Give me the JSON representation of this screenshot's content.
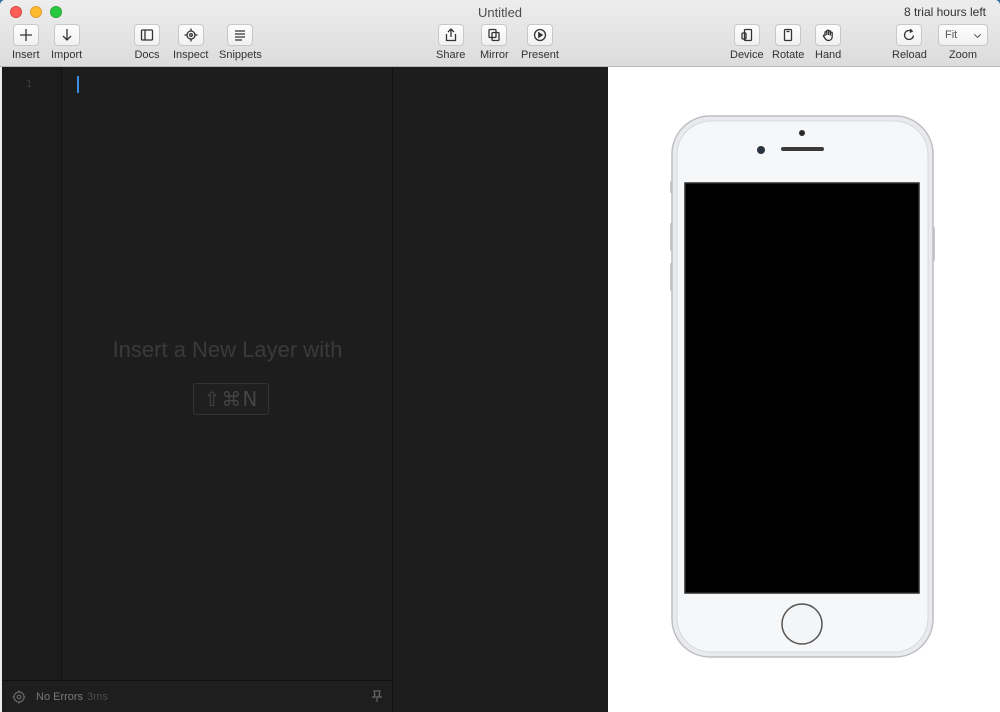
{
  "window": {
    "title": "Untitled",
    "trial_notice": "8 trial hours left"
  },
  "toolbar": {
    "insert": "Insert",
    "import": "Import",
    "docs": "Docs",
    "inspect": "Inspect",
    "snippets": "Snippets",
    "share": "Share",
    "mirror": "Mirror",
    "present": "Present",
    "device": "Device",
    "rotate": "Rotate",
    "hand": "Hand",
    "reload": "Reload",
    "zoom": "Zoom",
    "zoom_value": "Fit"
  },
  "editor": {
    "line_number": "1",
    "hint_text": "Insert a New Layer with",
    "shortcut": "⇧⌘N"
  },
  "statusbar": {
    "status": "No Errors",
    "time": "3ms"
  },
  "colors": {
    "accent": "#3d8ee0",
    "editor_bg": "#1d1d1d"
  }
}
